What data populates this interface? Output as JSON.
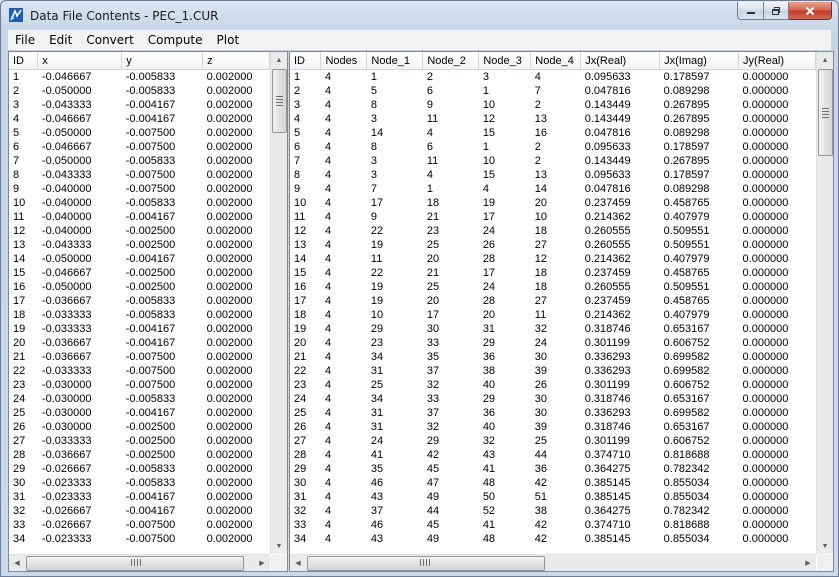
{
  "window": {
    "title": "Data File Contents - PEC_1.CUR",
    "caption": {
      "minimize": "—",
      "maximize": "❐",
      "close": "✕"
    }
  },
  "menu": [
    {
      "label": "File"
    },
    {
      "label": "Edit"
    },
    {
      "label": "Convert"
    },
    {
      "label": "Compute"
    },
    {
      "label": "Plot"
    }
  ],
  "nodes_table": {
    "columns": [
      "ID",
      "x",
      "y",
      "z"
    ],
    "rows": [
      [
        "1",
        "-0.046667",
        "-0.005833",
        "0.002000"
      ],
      [
        "2",
        "-0.050000",
        "-0.005833",
        "0.002000"
      ],
      [
        "3",
        "-0.043333",
        "-0.004167",
        "0.002000"
      ],
      [
        "4",
        "-0.046667",
        "-0.004167",
        "0.002000"
      ],
      [
        "5",
        "-0.050000",
        "-0.007500",
        "0.002000"
      ],
      [
        "6",
        "-0.046667",
        "-0.007500",
        "0.002000"
      ],
      [
        "7",
        "-0.050000",
        "-0.005833",
        "0.002000"
      ],
      [
        "8",
        "-0.043333",
        "-0.007500",
        "0.002000"
      ],
      [
        "9",
        "-0.040000",
        "-0.007500",
        "0.002000"
      ],
      [
        "10",
        "-0.040000",
        "-0.005833",
        "0.002000"
      ],
      [
        "11",
        "-0.040000",
        "-0.004167",
        "0.002000"
      ],
      [
        "12",
        "-0.040000",
        "-0.002500",
        "0.002000"
      ],
      [
        "13",
        "-0.043333",
        "-0.002500",
        "0.002000"
      ],
      [
        "14",
        "-0.050000",
        "-0.004167",
        "0.002000"
      ],
      [
        "15",
        "-0.046667",
        "-0.002500",
        "0.002000"
      ],
      [
        "16",
        "-0.050000",
        "-0.002500",
        "0.002000"
      ],
      [
        "17",
        "-0.036667",
        "-0.005833",
        "0.002000"
      ],
      [
        "18",
        "-0.033333",
        "-0.005833",
        "0.002000"
      ],
      [
        "19",
        "-0.033333",
        "-0.004167",
        "0.002000"
      ],
      [
        "20",
        "-0.036667",
        "-0.004167",
        "0.002000"
      ],
      [
        "21",
        "-0.036667",
        "-0.007500",
        "0.002000"
      ],
      [
        "22",
        "-0.033333",
        "-0.007500",
        "0.002000"
      ],
      [
        "23",
        "-0.030000",
        "-0.007500",
        "0.002000"
      ],
      [
        "24",
        "-0.030000",
        "-0.005833",
        "0.002000"
      ],
      [
        "25",
        "-0.030000",
        "-0.004167",
        "0.002000"
      ],
      [
        "26",
        "-0.030000",
        "-0.002500",
        "0.002000"
      ],
      [
        "27",
        "-0.033333",
        "-0.002500",
        "0.002000"
      ],
      [
        "28",
        "-0.036667",
        "-0.002500",
        "0.002000"
      ],
      [
        "29",
        "-0.026667",
        "-0.005833",
        "0.002000"
      ],
      [
        "30",
        "-0.023333",
        "-0.005833",
        "0.002000"
      ],
      [
        "31",
        "-0.023333",
        "-0.004167",
        "0.002000"
      ],
      [
        "32",
        "-0.026667",
        "-0.004167",
        "0.002000"
      ],
      [
        "33",
        "-0.026667",
        "-0.007500",
        "0.002000"
      ],
      [
        "34",
        "-0.023333",
        "-0.007500",
        "0.002000"
      ]
    ]
  },
  "elements_table": {
    "columns": [
      "ID",
      "Nodes",
      "Node_1",
      "Node_2",
      "Node_3",
      "Node_4",
      "Jx(Real)",
      "Jx(Imag)",
      "Jy(Real)"
    ],
    "rows": [
      [
        "1",
        "4",
        "1",
        "2",
        "3",
        "4",
        "0.095633",
        "0.178597",
        "0.000000"
      ],
      [
        "2",
        "4",
        "5",
        "6",
        "1",
        "7",
        "0.047816",
        "0.089298",
        "0.000000"
      ],
      [
        "3",
        "4",
        "8",
        "9",
        "10",
        "2",
        "0.143449",
        "0.267895",
        "0.000000"
      ],
      [
        "4",
        "4",
        "3",
        "11",
        "12",
        "13",
        "0.143449",
        "0.267895",
        "0.000000"
      ],
      [
        "5",
        "4",
        "14",
        "4",
        "15",
        "16",
        "0.047816",
        "0.089298",
        "0.000000"
      ],
      [
        "6",
        "4",
        "8",
        "6",
        "1",
        "2",
        "0.095633",
        "0.178597",
        "0.000000"
      ],
      [
        "7",
        "4",
        "3",
        "11",
        "10",
        "2",
        "0.143449",
        "0.267895",
        "0.000000"
      ],
      [
        "8",
        "4",
        "3",
        "4",
        "15",
        "13",
        "0.095633",
        "0.178597",
        "0.000000"
      ],
      [
        "9",
        "4",
        "7",
        "1",
        "4",
        "14",
        "0.047816",
        "0.089298",
        "0.000000"
      ],
      [
        "10",
        "4",
        "17",
        "18",
        "19",
        "20",
        "0.237459",
        "0.458765",
        "0.000000"
      ],
      [
        "11",
        "4",
        "9",
        "21",
        "17",
        "10",
        "0.214362",
        "0.407979",
        "0.000000"
      ],
      [
        "12",
        "4",
        "22",
        "23",
        "24",
        "18",
        "0.260555",
        "0.509551",
        "0.000000"
      ],
      [
        "13",
        "4",
        "19",
        "25",
        "26",
        "27",
        "0.260555",
        "0.509551",
        "0.000000"
      ],
      [
        "14",
        "4",
        "11",
        "20",
        "28",
        "12",
        "0.214362",
        "0.407979",
        "0.000000"
      ],
      [
        "15",
        "4",
        "22",
        "21",
        "17",
        "18",
        "0.237459",
        "0.458765",
        "0.000000"
      ],
      [
        "16",
        "4",
        "19",
        "25",
        "24",
        "18",
        "0.260555",
        "0.509551",
        "0.000000"
      ],
      [
        "17",
        "4",
        "19",
        "20",
        "28",
        "27",
        "0.237459",
        "0.458765",
        "0.000000"
      ],
      [
        "18",
        "4",
        "10",
        "17",
        "20",
        "11",
        "0.214362",
        "0.407979",
        "0.000000"
      ],
      [
        "19",
        "4",
        "29",
        "30",
        "31",
        "32",
        "0.318746",
        "0.653167",
        "0.000000"
      ],
      [
        "20",
        "4",
        "23",
        "33",
        "29",
        "24",
        "0.301199",
        "0.606752",
        "0.000000"
      ],
      [
        "21",
        "4",
        "34",
        "35",
        "36",
        "30",
        "0.336293",
        "0.699582",
        "0.000000"
      ],
      [
        "22",
        "4",
        "31",
        "37",
        "38",
        "39",
        "0.336293",
        "0.699582",
        "0.000000"
      ],
      [
        "23",
        "4",
        "25",
        "32",
        "40",
        "26",
        "0.301199",
        "0.606752",
        "0.000000"
      ],
      [
        "24",
        "4",
        "34",
        "33",
        "29",
        "30",
        "0.318746",
        "0.653167",
        "0.000000"
      ],
      [
        "25",
        "4",
        "31",
        "37",
        "36",
        "30",
        "0.336293",
        "0.699582",
        "0.000000"
      ],
      [
        "26",
        "4",
        "31",
        "32",
        "40",
        "39",
        "0.318746",
        "0.653167",
        "0.000000"
      ],
      [
        "27",
        "4",
        "24",
        "29",
        "32",
        "25",
        "0.301199",
        "0.606752",
        "0.000000"
      ],
      [
        "28",
        "4",
        "41",
        "42",
        "43",
        "44",
        "0.374710",
        "0.818688",
        "0.000000"
      ],
      [
        "29",
        "4",
        "35",
        "45",
        "41",
        "36",
        "0.364275",
        "0.782342",
        "0.000000"
      ],
      [
        "30",
        "4",
        "46",
        "47",
        "48",
        "42",
        "0.385145",
        "0.855034",
        "0.000000"
      ],
      [
        "31",
        "4",
        "43",
        "49",
        "50",
        "51",
        "0.385145",
        "0.855034",
        "0.000000"
      ],
      [
        "32",
        "4",
        "37",
        "44",
        "52",
        "38",
        "0.364275",
        "0.782342",
        "0.000000"
      ],
      [
        "33",
        "4",
        "46",
        "45",
        "41",
        "42",
        "0.374710",
        "0.818688",
        "0.000000"
      ],
      [
        "34",
        "4",
        "43",
        "49",
        "48",
        "42",
        "0.385145",
        "0.855034",
        "0.000000"
      ]
    ]
  },
  "scroll": {
    "up": "▲",
    "down": "▼",
    "left": "◀",
    "right": "▶"
  },
  "colors": {
    "accent": "#1a5fb4",
    "close": "#c0392a"
  }
}
